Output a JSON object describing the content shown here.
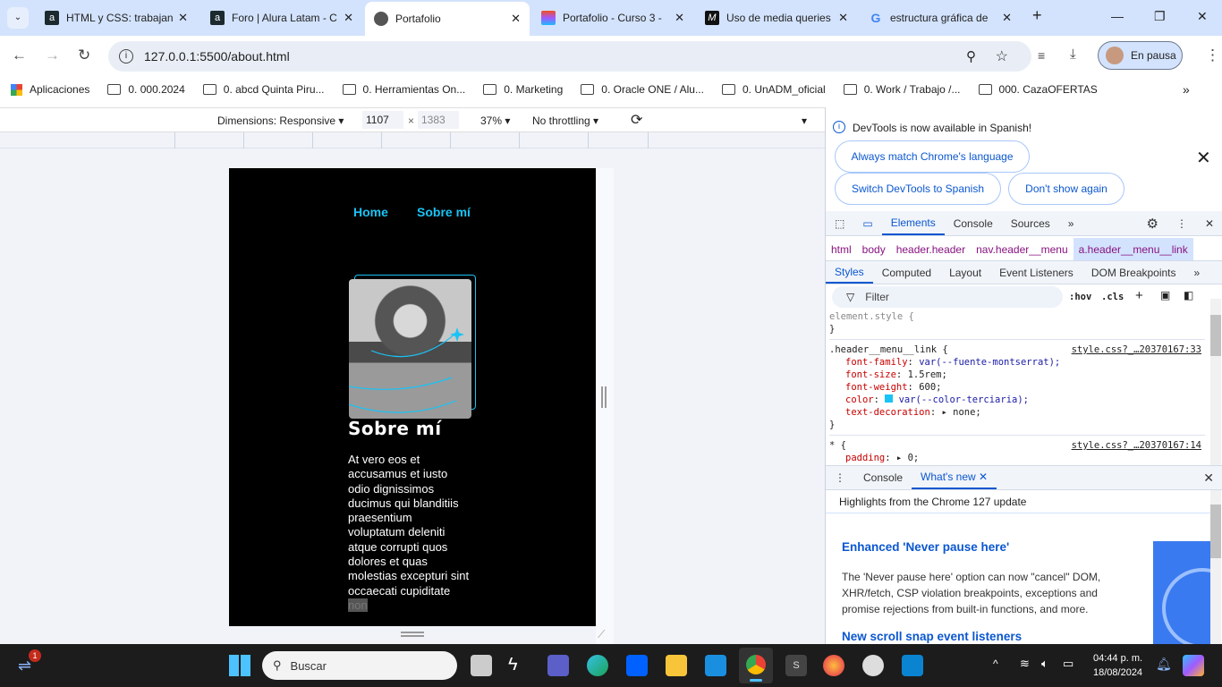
{
  "browser": {
    "tabs": [
      {
        "title": "HTML y CSS: trabajan",
        "icon": "alura-icon",
        "active": false
      },
      {
        "title": "Foro | Alura Latam - C",
        "icon": "alura-icon",
        "active": false
      },
      {
        "title": "Portafolio",
        "icon": "globe-icon",
        "active": true
      },
      {
        "title": "Portafolio - Curso 3 -",
        "icon": "figma-icon",
        "active": false
      },
      {
        "title": "Uso de media queries",
        "icon": "medium-icon",
        "active": false
      },
      {
        "title": "estructura gráfica de",
        "icon": "google-icon",
        "active": false
      }
    ],
    "url": "127.0.0.1:5500/about.html",
    "profile_label": "En pausa",
    "bookmarks": [
      "Aplicaciones",
      "0. 000.2024",
      "0. abcd Quinta Piru...",
      "0. Herramientas On...",
      "0. Marketing",
      "0. Oracle ONE / Alu...",
      "0. UnADM_oficial",
      "0. Work / Trabajo /...",
      "000. CazaOFERTAS"
    ]
  },
  "device_toolbar": {
    "dimensions": "Dimensions: Responsive",
    "width": "1107",
    "height": "1383",
    "zoom": "37%",
    "throttling": "No throttling"
  },
  "page": {
    "nav": [
      "Home",
      "Sobre mí"
    ],
    "title": "Sobre mí",
    "body": "At vero eos et accusamus et iusto odio dignissimos ducimus qui blanditiis praesentium voluptatum deleniti atque corrupti quos dolores et quas molestias excepturi sint occaecati cupiditate",
    "highlight": "non",
    "accent": "#19c3f5"
  },
  "devtools": {
    "notice": "DevTools is now available in Spanish!",
    "btn_match": "Always match Chrome's language",
    "btn_switch": "Switch DevTools to Spanish",
    "btn_dont": "Don't show again",
    "tabs": [
      "Elements",
      "Console",
      "Sources"
    ],
    "breadcrumbs": [
      "html",
      "body",
      "header.header",
      "nav.header__menu",
      "a.header__menu__link"
    ],
    "subtabs": [
      "Styles",
      "Computed",
      "Layout",
      "Event Listeners",
      "DOM Breakpoints"
    ],
    "filter_placeholder": "Filter",
    "hov": ":hov",
    "cls": ".cls",
    "element_style": "element.style {",
    "rule_selector": ".header__menu__link {",
    "rule_source": "style.css?_…20370167:33",
    "props": [
      {
        "name": "font-family",
        "value": "var(--fuente-montserrat);"
      },
      {
        "name": "font-size",
        "value": "1.5rem;"
      },
      {
        "name": "font-weight",
        "value": "600;"
      },
      {
        "name": "color",
        "value": "var(--color-terciaria);"
      },
      {
        "name": "text-decoration",
        "value": "none;"
      }
    ],
    "rule2_selector": "* {",
    "rule2_source": "style.css?_…20370167:14",
    "rule2_prop": {
      "name": "padding",
      "value": "0;"
    },
    "color_swatch": "#19c3f5",
    "drawer_tabs": [
      "Console",
      "What's new"
    ],
    "whatsnew_header": "Highlights from the Chrome 127 update",
    "h1": "Enhanced 'Never pause here'",
    "p1": "The 'Never pause here' option can now \"cancel\" DOM, XHR/fetch, CSP violation breakpoints, exceptions and promise rejections from built-in functions, and more.",
    "h2": "New scroll snap event listeners"
  },
  "taskbar": {
    "search": "Buscar",
    "time": "04:44 p. m.",
    "date": "18/08/2024",
    "badge": "1"
  }
}
